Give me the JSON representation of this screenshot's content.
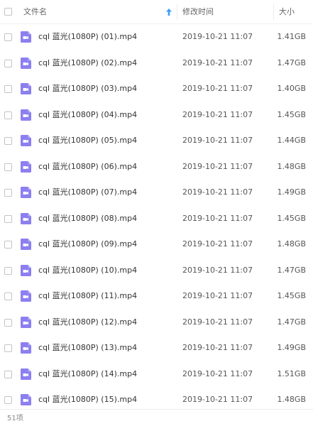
{
  "header": {
    "name_label": "文件名",
    "modified_label": "修改时间",
    "size_label": "大小"
  },
  "accent_color": "#3b9dff",
  "file_icon_color": "#8c7ff0",
  "files": [
    {
      "name": "cql 蓝光(1080P) (01).mp4",
      "date": "2019-10-21 11:07",
      "size": "1.41GB",
      "icon": "video-file-icon"
    },
    {
      "name": "cql 蓝光(1080P) (02).mp4",
      "date": "2019-10-21 11:07",
      "size": "1.47GB",
      "icon": "video-file-icon"
    },
    {
      "name": "cql 蓝光(1080P) (03).mp4",
      "date": "2019-10-21 11:07",
      "size": "1.40GB",
      "icon": "video-file-icon"
    },
    {
      "name": "cql 蓝光(1080P) (04).mp4",
      "date": "2019-10-21 11:07",
      "size": "1.45GB",
      "icon": "video-file-icon"
    },
    {
      "name": "cql 蓝光(1080P) (05).mp4",
      "date": "2019-10-21 11:07",
      "size": "1.44GB",
      "icon": "video-file-icon"
    },
    {
      "name": "cql 蓝光(1080P) (06).mp4",
      "date": "2019-10-21 11:07",
      "size": "1.48GB",
      "icon": "video-file-icon"
    },
    {
      "name": "cql 蓝光(1080P) (07).mp4",
      "date": "2019-10-21 11:07",
      "size": "1.49GB",
      "icon": "video-file-icon"
    },
    {
      "name": "cql 蓝光(1080P) (08).mp4",
      "date": "2019-10-21 11:07",
      "size": "1.45GB",
      "icon": "video-file-icon"
    },
    {
      "name": "cql 蓝光(1080P) (09).mp4",
      "date": "2019-10-21 11:07",
      "size": "1.48GB",
      "icon": "video-file-icon"
    },
    {
      "name": "cql 蓝光(1080P) (10).mp4",
      "date": "2019-10-21 11:07",
      "size": "1.47GB",
      "icon": "video-file-icon"
    },
    {
      "name": "cql 蓝光(1080P) (11).mp4",
      "date": "2019-10-21 11:07",
      "size": "1.45GB",
      "icon": "video-file-icon"
    },
    {
      "name": "cql 蓝光(1080P) (12).mp4",
      "date": "2019-10-21 11:07",
      "size": "1.47GB",
      "icon": "video-file-icon"
    },
    {
      "name": "cql 蓝光(1080P) (13).mp4",
      "date": "2019-10-21 11:07",
      "size": "1.49GB",
      "icon": "video-file-icon"
    },
    {
      "name": "cql 蓝光(1080P) (14).mp4",
      "date": "2019-10-21 11:07",
      "size": "1.51GB",
      "icon": "video-file-icon"
    },
    {
      "name": "cql 蓝光(1080P) (15).mp4",
      "date": "2019-10-21 11:07",
      "size": "1.48GB",
      "icon": "video-file-icon"
    }
  ],
  "footer": {
    "item_count": "51项"
  }
}
